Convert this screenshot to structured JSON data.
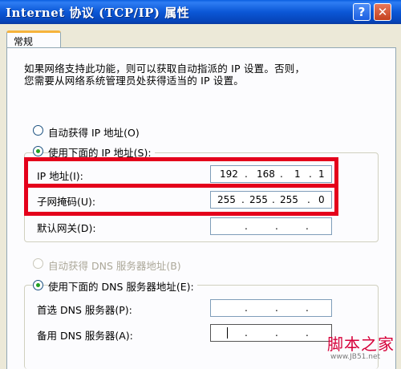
{
  "window": {
    "title": "Internet 协议 (TCP/IP) 属性",
    "help_glyph": "?",
    "close_glyph": "✕"
  },
  "tabs": [
    {
      "label": "常规",
      "selected": true
    }
  ],
  "description": [
    "如果网络支持此功能，则可以获取自动指派的 IP 设置。否则，",
    "您需要从网络系统管理员处获得适当的 IP 设置。"
  ],
  "ip_section": {
    "auto_option": {
      "label": "自动获得 IP 地址(O)",
      "selected": false
    },
    "manual_option": {
      "label": "使用下面的 IP 地址(S):",
      "selected": true
    },
    "fields": [
      {
        "label": "IP 地址(I):",
        "octets": [
          "192",
          "168",
          "1",
          "1"
        ]
      },
      {
        "label": "子网掩码(U):",
        "octets": [
          "255",
          "255",
          "255",
          "0"
        ]
      },
      {
        "label": "默认网关(D):",
        "octets": [
          "",
          "",
          "",
          ""
        ]
      }
    ]
  },
  "dns_section": {
    "auto_option": {
      "label": "自动获得 DNS 服务器地址(B)",
      "selected": false,
      "disabled": true
    },
    "manual_option": {
      "label": "使用下面的 DNS 服务器地址(E):",
      "selected": true
    },
    "fields": [
      {
        "label": "首选 DNS 服务器(P):",
        "octets": [
          "",
          "",
          "",
          ""
        ]
      },
      {
        "label": "备用 DNS 服务器(A):",
        "octets": [
          "",
          "",
          "",
          ""
        ]
      }
    ]
  },
  "watermark": {
    "brand": "脚本之家",
    "url": "www.JB51.net"
  },
  "colors": {
    "highlight": "#e4001b",
    "titlebar": "#0b57d6",
    "radio_dot": "#21a121"
  }
}
